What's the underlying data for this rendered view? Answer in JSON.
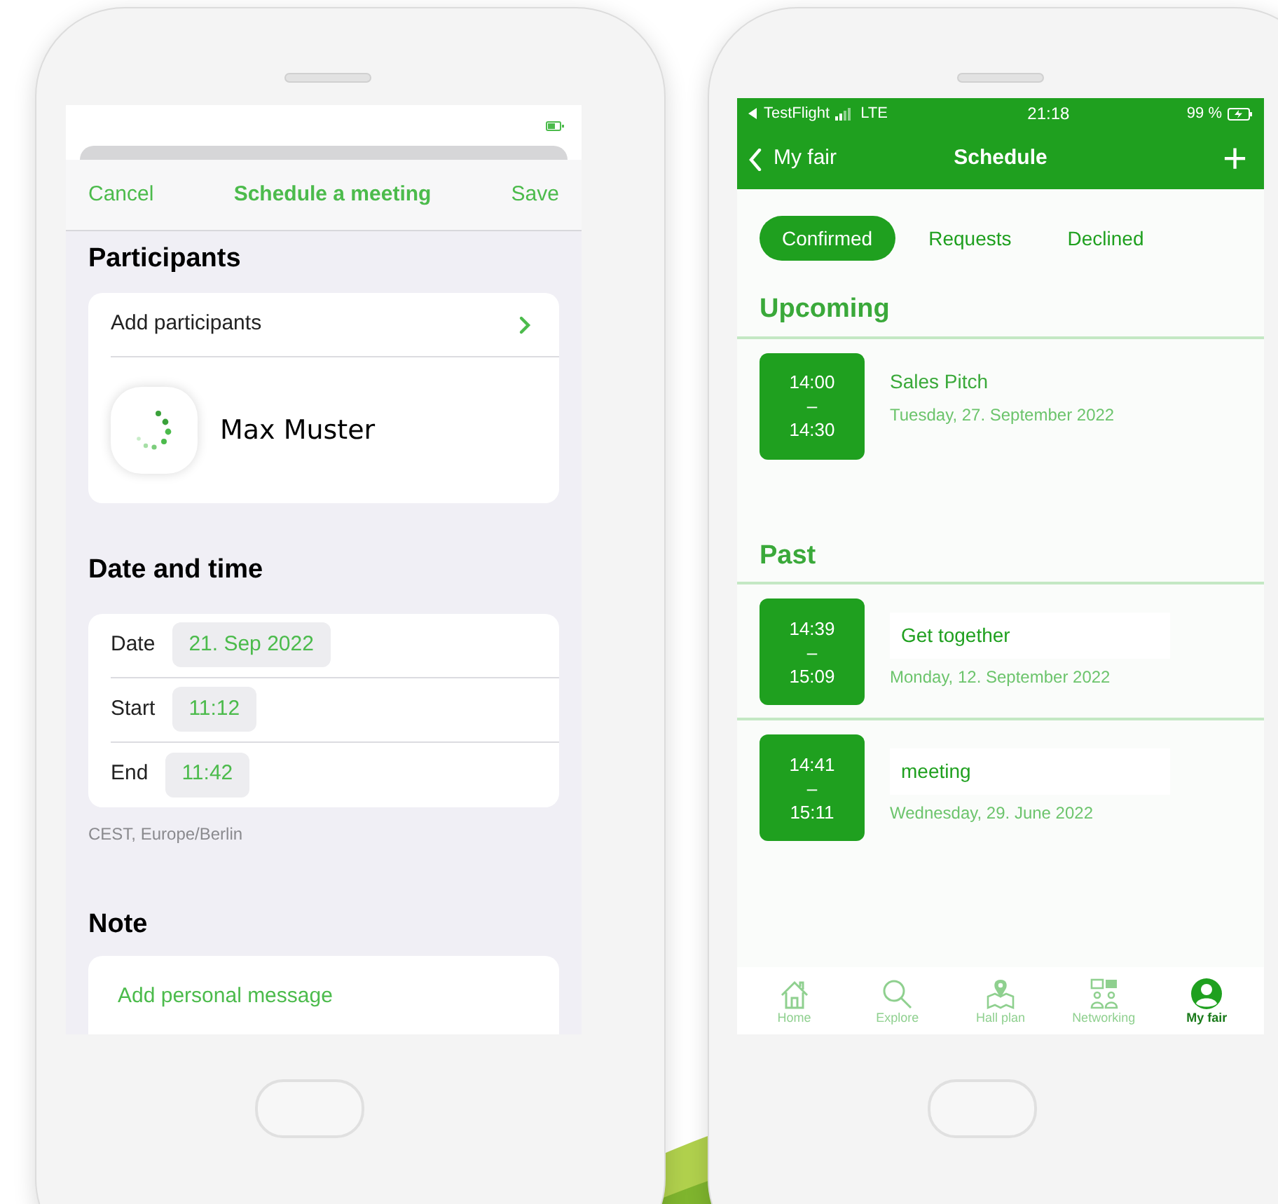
{
  "left_screen": {
    "nav": {
      "cancel": "Cancel",
      "title": "Schedule a meeting",
      "save": "Save"
    },
    "participants": {
      "heading": "Participants",
      "add_label": "Add participants",
      "people": [
        {
          "name": "Max Muster"
        }
      ]
    },
    "date_time": {
      "heading": "Date and time",
      "rows": [
        {
          "label": "Date",
          "value": "21. Sep 2022"
        },
        {
          "label": "Start",
          "value": "11:12"
        },
        {
          "label": "End",
          "value": "11:42"
        }
      ],
      "timezone": "CEST, Europe/Berlin"
    },
    "note": {
      "heading": "Note",
      "placeholder": "Add personal message"
    }
  },
  "right_screen": {
    "status_bar": {
      "carrier": "TestFlight",
      "network": "LTE",
      "time": "21:18",
      "battery": "99 %"
    },
    "nav": {
      "back": "My fair",
      "title": "Schedule",
      "add": "+"
    },
    "tabs": [
      {
        "label": "Confirmed",
        "selected": true
      },
      {
        "label": "Requests",
        "selected": false
      },
      {
        "label": "Declined",
        "selected": false
      }
    ],
    "sections": [
      {
        "title": "Upcoming",
        "meetings": [
          {
            "start": "14:00",
            "separator": "–",
            "end": "14:30",
            "title": "Sales Pitch",
            "date": "Tuesday, 27. September 2022"
          }
        ]
      },
      {
        "title": "Past",
        "meetings": [
          {
            "start": "14:39",
            "separator": "–",
            "end": "15:09",
            "title": "Get together",
            "date": "Monday, 12. September 2022"
          },
          {
            "start": "14:41",
            "separator": "–",
            "end": "15:11",
            "title": "meeting",
            "date": "Wednesday, 29. June 2022"
          }
        ]
      }
    ],
    "tab_bar": [
      {
        "kind": "home",
        "label": "Home",
        "selected": false
      },
      {
        "kind": "explore",
        "label": "Explore",
        "selected": false
      },
      {
        "kind": "map",
        "label": "Hall plan",
        "selected": false
      },
      {
        "kind": "network",
        "label": "Networking",
        "selected": false
      },
      {
        "kind": "profile",
        "label": "My fair",
        "selected": true
      }
    ]
  }
}
